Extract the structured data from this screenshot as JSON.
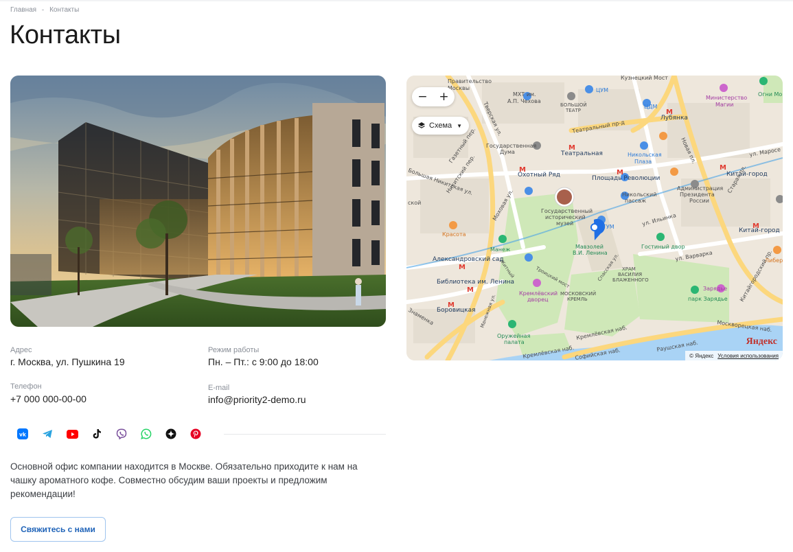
{
  "breadcrumb": {
    "home": "Главная",
    "current": "Контакты"
  },
  "page": {
    "title": "Контакты"
  },
  "contacts": {
    "address_label": "Адрес",
    "address": "г. Москва, ул. Пушкина 19",
    "hours_label": "Режим работы",
    "hours": "Пн. – Пт.: с 9:00 до 18:00",
    "phone_label": "Телефон",
    "phone": "+7 000 000-00-00",
    "email_label": "E-mail",
    "email": "info@priority2-demo.ru"
  },
  "socials": [
    "vk-icon",
    "telegram-icon",
    "youtube-icon",
    "tiktok-icon",
    "viber-icon",
    "whatsapp-icon",
    "zen-icon",
    "pinterest-icon"
  ],
  "description": "Основной офис компании находится в Москве. Обязательно приходите к нам на чашку ароматного кофе. Совместно обсудим ваши проекты и предложим рекомендации!",
  "button": {
    "label": "Свяжитесь с нами"
  },
  "map": {
    "zoom_out": "−",
    "zoom_in": "+",
    "layer": "Схема",
    "logo": "Яндекс",
    "copyright": "© Яндекс",
    "terms": "Условия использования",
    "labels": {
      "kuznetsky": "Кузнецкий Мост",
      "pravitelstvo": "Правительство",
      "moskvy": "Москвы",
      "mht": "МХТ им.",
      "chekhov": "А.П. Чехова",
      "tsum1": "ЦУМ",
      "bolshoi1": "БОЛЬШОЙ",
      "bolshoi2": "ТЕАТР",
      "tsdm": "ЦДМ",
      "lubyanka": "Лубянка",
      "ministry1": "Министерство",
      "ministry2": "Магии",
      "ogni": "Огни Мо",
      "teatr_proezd": "Театральный пр-д",
      "tverskaya": "Тверская ул.",
      "duma1": "Государственная",
      "duma2": "Дума",
      "teatralnaya": "Театральная",
      "nikolskaya1": "Никольская",
      "nikolskaya2": "Плаза",
      "novaya": "Новая пл.",
      "maroseyka": "ул. Маросе",
      "gazetny": "Газетный пер.",
      "okhotny": "Охотный Ряд",
      "pl_rev": "Площадь Революции",
      "kitay1": "Китай-город",
      "nikitskaya": "Большая Никитская ул.",
      "nikitsky_per": "Никитский пер.",
      "museum1": "Государственный",
      "museum2": "исторический",
      "museum3": "музей",
      "nik_passage1": "Никольский",
      "nik_passage2": "пассаж",
      "admin1": "Администрация",
      "admin2": "Президента",
      "admin3": "России",
      "ilyinka": "ул. Ильинка",
      "staraya": "Старая пл.",
      "mokhovaya": "Моховая ул.",
      "krasota": "Красота",
      "gum": "ГУМ",
      "mausoleum1": "Мавзолей",
      "mausoleum2": "В.И. Ленина",
      "gostiny": "Гостиный двор",
      "kitay2": "Китай-город",
      "manezh": "Манеж",
      "alex_sad": "Александровский сад",
      "varvarka": "ул. Варварка",
      "libera": "Либер",
      "lenin_lib": "Библиотека им. Ленина",
      "troitsky": "Троицкий мост",
      "spassky": "Спасская ул.",
      "kremlin1": "МОСКОВСКИЙ",
      "kremlin2": "КРЕМЛЬ",
      "vasily1": "ХРАМ",
      "vasily2": "ВАСИЛИЯ",
      "vasily3": "БЛАЖЕННОГО",
      "zaryadye": "Зарядье",
      "park_zaryadye": "парк Зарядье",
      "kitaygorod_pr": "Китайгородский пр.",
      "kremlin_palace1": "Кремлёвский",
      "kremlin_palace2": "дворец",
      "borovitskaya": "Боровицкая",
      "znamenka": "Знаменка",
      "armory1": "Оружейная",
      "armory2": "палата",
      "moskvoretskaya": "Москворецкая наб.",
      "kremlevskaya1": "Кремлёвская наб.",
      "kremlevskaya2": "Кремлёвская наб.",
      "raushskaya": "Раушская наб.",
      "sofiyskaya": "Софийская наб.",
      "mokhovaya2": "Моховая ул.",
      "manezhnaya": "Манежная ул.",
      "zhitny": "Житный",
      "skoy": "ской"
    }
  }
}
